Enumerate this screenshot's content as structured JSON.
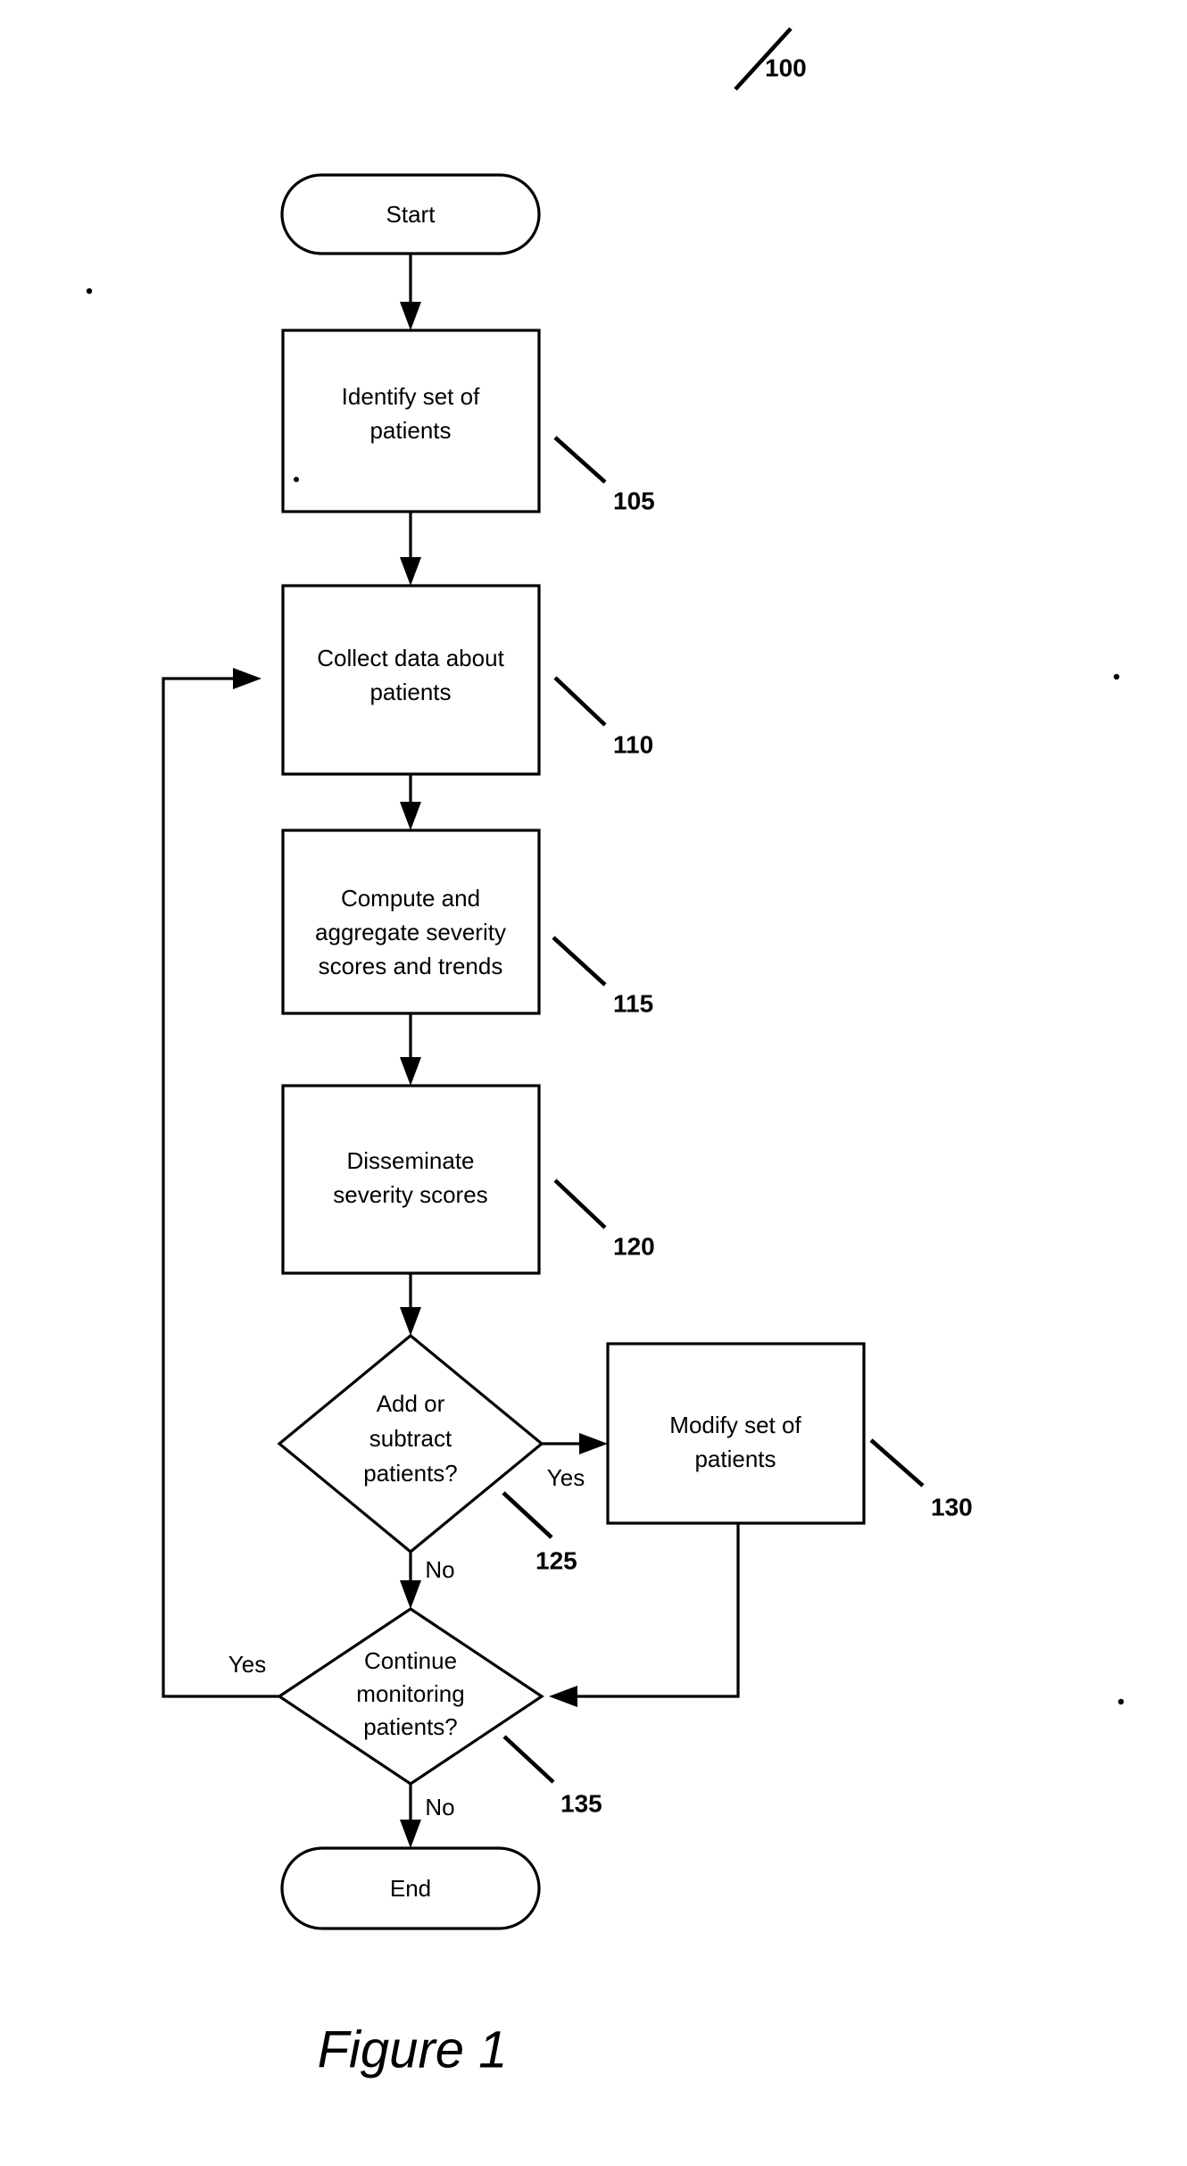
{
  "figure": {
    "caption": "Figure 1",
    "diagram_reference": "100",
    "type": "flowchart"
  },
  "nodes": [
    {
      "id": "start",
      "shape": "terminator",
      "label": "Start",
      "lines": [
        "Start"
      ],
      "ref": ""
    },
    {
      "id": "identify",
      "shape": "process",
      "label": "Identify set of patients",
      "lines": [
        "Identify set of",
        "patients"
      ],
      "ref": "105"
    },
    {
      "id": "collect",
      "shape": "process",
      "label": "Collect data about patients",
      "lines": [
        "Collect data about",
        "patients"
      ],
      "ref": "110"
    },
    {
      "id": "compute",
      "shape": "process",
      "label": "Compute and aggregate severity scores and trends",
      "lines": [
        "Compute and",
        "aggregate severity",
        "scores and trends"
      ],
      "ref": "115"
    },
    {
      "id": "disseminate",
      "shape": "process",
      "label": "Disseminate severity scores",
      "lines": [
        "Disseminate",
        "severity scores"
      ],
      "ref": "120"
    },
    {
      "id": "addsubtract",
      "shape": "decision",
      "label": "Add or subtract patients?",
      "lines": [
        "Add or",
        "subtract",
        "patients?"
      ],
      "ref": "125"
    },
    {
      "id": "modify",
      "shape": "process",
      "label": "Modify set of patients",
      "lines": [
        "Modify set of",
        "patients"
      ],
      "ref": "130"
    },
    {
      "id": "continue",
      "shape": "decision",
      "label": "Continue monitoring patients?",
      "lines": [
        "Continue",
        "monitoring",
        "patients?"
      ],
      "ref": "135"
    },
    {
      "id": "end",
      "shape": "terminator",
      "label": "End",
      "lines": [
        "End"
      ],
      "ref": ""
    }
  ],
  "edges": [
    {
      "id": "start-identify",
      "from": "start",
      "to": "identify",
      "label": ""
    },
    {
      "id": "identify-collect",
      "from": "identify",
      "to": "collect",
      "label": ""
    },
    {
      "id": "collect-compute",
      "from": "collect",
      "to": "compute",
      "label": ""
    },
    {
      "id": "compute-disseminate",
      "from": "compute",
      "to": "disseminate",
      "label": ""
    },
    {
      "id": "disseminate-addsubtract",
      "from": "disseminate",
      "to": "addsubtract",
      "label": ""
    },
    {
      "id": "addsubtract-modify",
      "from": "addsubtract",
      "to": "modify",
      "label": "Yes"
    },
    {
      "id": "addsubtract-continue",
      "from": "addsubtract",
      "to": "continue",
      "label": "No"
    },
    {
      "id": "modify-continue",
      "from": "modify",
      "to": "continue",
      "label": ""
    },
    {
      "id": "continue-collect",
      "from": "continue",
      "to": "collect",
      "label": "Yes"
    },
    {
      "id": "continue-end",
      "from": "continue",
      "to": "end",
      "label": "No"
    }
  ],
  "reference_numerals": [
    "100",
    "105",
    "110",
    "115",
    "120",
    "125",
    "130",
    "135"
  ],
  "colors": {
    "background": "#ffffff",
    "stroke": "#000000",
    "text": "#000000"
  }
}
